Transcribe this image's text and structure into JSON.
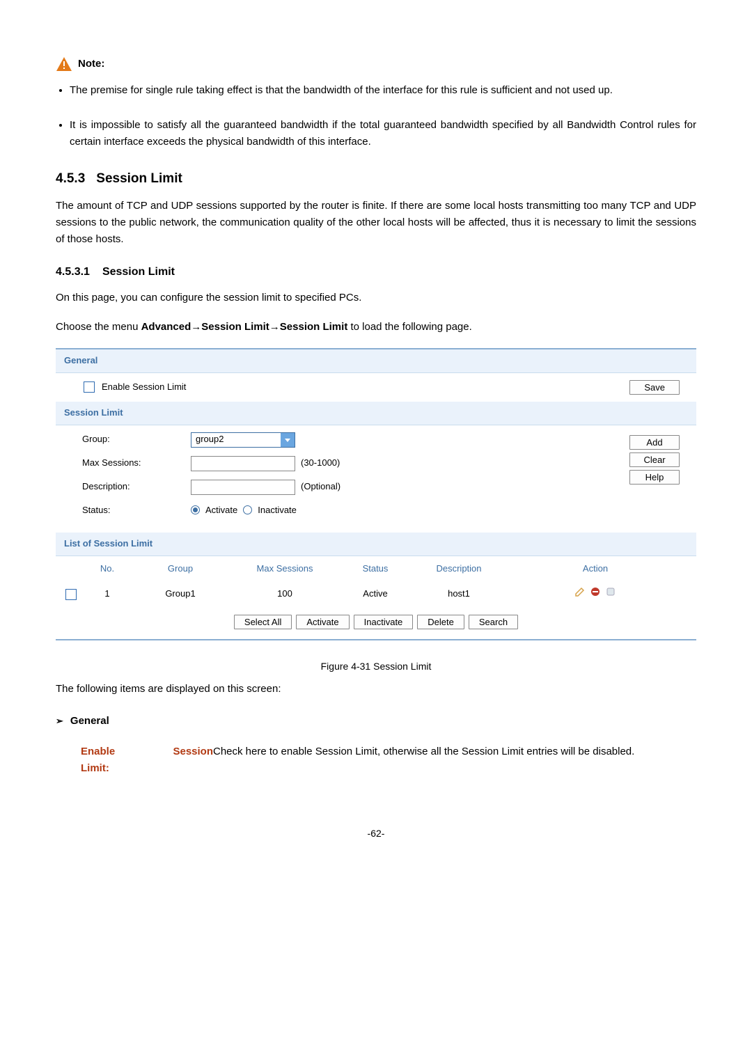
{
  "note": {
    "label": "Note:",
    "items": [
      "The premise for single rule taking effect is that the bandwidth of the interface for this rule is sufficient and not used up.",
      "It is impossible to satisfy all the guaranteed bandwidth if the total guaranteed bandwidth specified by all Bandwidth Control rules for certain interface exceeds the physical bandwidth of this interface."
    ]
  },
  "section": {
    "num": "4.5.3",
    "title": "Session Limit",
    "intro": "The amount of TCP and UDP sessions supported by the router is finite. If there are some local hosts transmitting too many TCP and UDP sessions to the public network, the communication quality of the other local hosts will be affected, thus it is necessary to limit the sessions of those hosts."
  },
  "subsection": {
    "num": "4.5.3.1",
    "title": "Session Limit",
    "desc": "On this page, you can configure the session limit to specified PCs.",
    "pathPrefix": "Choose the menu ",
    "pathBold": "Advanced→Session Limit→Session Limit",
    "pathSuffix": " to load the following page."
  },
  "panel": {
    "generalHeader": "General",
    "enableLabel": "Enable Session Limit",
    "saveBtn": "Save",
    "sessionHeader": "Session Limit",
    "form": {
      "groupLabel": "Group:",
      "groupValue": "group2",
      "maxLabel": "Max Sessions:",
      "maxHint": "(30-1000)",
      "descLabel": "Description:",
      "descHint": "(Optional)",
      "statusLabel": "Status:",
      "activate": "Activate",
      "inactivate": "Inactivate"
    },
    "sideBtns": {
      "add": "Add",
      "clear": "Clear",
      "help": "Help"
    },
    "listHeader": "List of Session Limit",
    "cols": {
      "no": "No.",
      "group": "Group",
      "max": "Max Sessions",
      "status": "Status",
      "desc": "Description",
      "action": "Action"
    },
    "rows": [
      {
        "no": "1",
        "group": "Group1",
        "max": "100",
        "status": "Active",
        "desc": "host1"
      }
    ],
    "btns": {
      "selectAll": "Select All",
      "activate": "Activate",
      "inactivate": "Inactivate",
      "delete": "Delete",
      "search": "Search"
    }
  },
  "figureCaption": "Figure 4-31 Session Limit",
  "followText": "The following items are displayed on this screen:",
  "generalArrow": "General",
  "def": {
    "termLine1": "Enable",
    "termLine1b": "Session",
    "termLine2": "Limit:",
    "desc": "Check here to enable Session Limit, otherwise all the Session Limit entries will be disabled."
  },
  "pageNo": "-62-"
}
